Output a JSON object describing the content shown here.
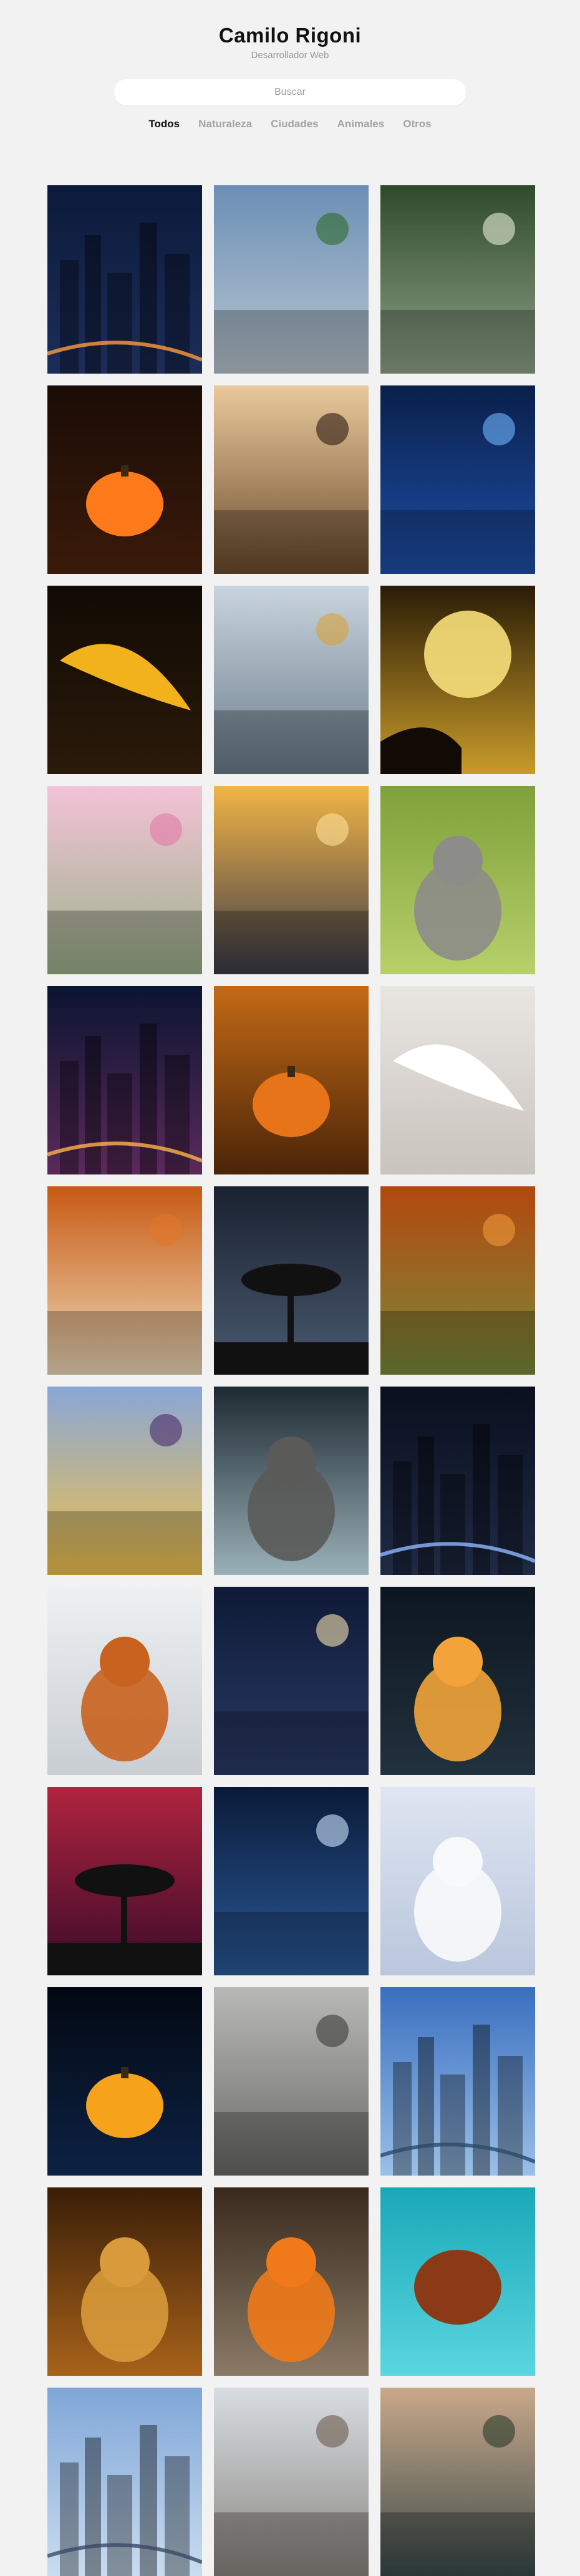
{
  "header": {
    "title": "Camilo Rigoni",
    "subtitle": "Desarrollador Web"
  },
  "search": {
    "placeholder": "Buscar"
  },
  "tabs": [
    {
      "label": "Todos",
      "active": true
    },
    {
      "label": "Naturaleza",
      "active": false
    },
    {
      "label": "Ciudades",
      "active": false
    },
    {
      "label": "Animales",
      "active": false
    },
    {
      "label": "Otros",
      "active": false
    }
  ],
  "gallery": [
    {
      "name": "city-night-traffic-photo",
      "bg": [
        "#0b1a3a",
        "#1c2d5a"
      ],
      "accent": "#ff9a3c",
      "motif": "city"
    },
    {
      "name": "seaside-promenade-photo",
      "bg": [
        "#6b8fb5",
        "#b9c6cf"
      ],
      "accent": "#2f6b2a",
      "motif": "street"
    },
    {
      "name": "forest-light-rays-photo",
      "bg": [
        "#2f4a2a",
        "#8fa28a"
      ],
      "accent": "#e6ecd9",
      "motif": "forest"
    },
    {
      "name": "halloween-pumpkin-spider-photo",
      "bg": [
        "#1a0c06",
        "#3a1a0a"
      ],
      "accent": "#ff7a1a",
      "motif": "pumpkin"
    },
    {
      "name": "misty-woods-deer-photo",
      "bg": [
        "#e9c99b",
        "#6b4a2c"
      ],
      "accent": "#2b1a10",
      "motif": "trees"
    },
    {
      "name": "blue-butterflies-photo",
      "bg": [
        "#0a1f4a",
        "#1f4fa8"
      ],
      "accent": "#6fb8ff",
      "motif": "butterfly"
    },
    {
      "name": "macaw-parrot-photo",
      "bg": [
        "#120a04",
        "#2a1a0a"
      ],
      "accent": "#f2b21b",
      "motif": "parrot"
    },
    {
      "name": "canal-boat-city-photo",
      "bg": [
        "#c9d4dd",
        "#6a7c8c"
      ],
      "accent": "#d8a23a",
      "motif": "canal"
    },
    {
      "name": "full-moon-bats-photo",
      "bg": [
        "#2a1c06",
        "#c89b2a"
      ],
      "accent": "#f7df7a",
      "motif": "moon"
    },
    {
      "name": "cherry-blossom-bridge-photo",
      "bg": [
        "#f3c3d6",
        "#9bb08a"
      ],
      "accent": "#e37aa6",
      "motif": "bridge"
    },
    {
      "name": "sunset-lake-photo",
      "bg": [
        "#f2b447",
        "#3a3a48"
      ],
      "accent": "#ffe09a",
      "motif": "lake"
    },
    {
      "name": "kitten-green-photo",
      "bg": [
        "#7fa03a",
        "#b7d06a"
      ],
      "accent": "#8c8c88",
      "motif": "cat"
    },
    {
      "name": "city-lights-aerial-photo",
      "bg": [
        "#0a1430",
        "#5b2a5a"
      ],
      "accent": "#ffb24a",
      "motif": "citylights"
    },
    {
      "name": "autumn-pumpkin-field-photo",
      "bg": [
        "#c46a16",
        "#4a2408"
      ],
      "accent": "#e8741a",
      "motif": "autumn"
    },
    {
      "name": "white-dove-photo",
      "bg": [
        "#e9e6e2",
        "#c9c3bd"
      ],
      "accent": "#ffffff",
      "motif": "dove"
    },
    {
      "name": "autumn-park-path-photo",
      "bg": [
        "#c85a14",
        "#efd9b8"
      ],
      "accent": "#e1772a",
      "motif": "park"
    },
    {
      "name": "bare-tree-moon-photo",
      "bg": [
        "#1a2230",
        "#4a5a70"
      ],
      "accent": "#d9d3c6",
      "motif": "baretree"
    },
    {
      "name": "autumn-forest-trail-photo",
      "bg": [
        "#b3480f",
        "#7a8a3a"
      ],
      "accent": "#f09a3a",
      "motif": "trail"
    },
    {
      "name": "sunset-mountains-photo",
      "bg": [
        "#8aa6d6",
        "#f0c24a"
      ],
      "accent": "#4a2a6a",
      "motif": "mountains"
    },
    {
      "name": "elephant-light-photo",
      "bg": [
        "#1e2a32",
        "#9ab0b8"
      ],
      "accent": "#5a5a58",
      "motif": "elephant"
    },
    {
      "name": "twin-light-beams-photo",
      "bg": [
        "#0a0f1e",
        "#1f2a44"
      ],
      "accent": "#8fb6ff",
      "motif": "beams"
    },
    {
      "name": "fox-snow-photo",
      "bg": [
        "#eef0f2",
        "#c9ced4"
      ],
      "accent": "#c9621e",
      "motif": "fox"
    },
    {
      "name": "capitol-night-photo",
      "bg": [
        "#0e1a36",
        "#2a3a66"
      ],
      "accent": "#f6e3b0",
      "motif": "capitol"
    },
    {
      "name": "rabbit-candles-photo",
      "bg": [
        "#0d1620",
        "#22313e"
      ],
      "accent": "#f2a43a",
      "motif": "rabbit"
    },
    {
      "name": "lone-tree-sunset-photo",
      "bg": [
        "#b0243e",
        "#3a0a2a"
      ],
      "accent": "#ff6a3a",
      "motif": "lonetree"
    },
    {
      "name": "bridge-river-night-photo",
      "bg": [
        "#0a1a38",
        "#2a5a9a"
      ],
      "accent": "#cfe6ff",
      "motif": "river"
    },
    {
      "name": "arctic-fox-snow-photo",
      "bg": [
        "#dfe6f2",
        "#b9c6dc"
      ],
      "accent": "#f8f9fb",
      "motif": "arcticfox"
    },
    {
      "name": "jack-o-lantern-photo",
      "bg": [
        "#020812",
        "#0d2244"
      ],
      "accent": "#f6a21a",
      "motif": "lantern"
    },
    {
      "name": "foggy-forest-photo",
      "bg": [
        "#b8b8b6",
        "#6a6a68"
      ],
      "accent": "#3a3a38",
      "motif": "fog"
    },
    {
      "name": "city-skyline-water-photo",
      "bg": [
        "#3a6fc0",
        "#9ac0e8"
      ],
      "accent": "#2a4a6a",
      "motif": "skyline"
    },
    {
      "name": "lion-portrait-photo",
      "bg": [
        "#3a1e08",
        "#a8621a"
      ],
      "accent": "#d89a3a",
      "motif": "lion"
    },
    {
      "name": "owl-eyes-photo",
      "bg": [
        "#3a2a1e",
        "#8a7a66"
      ],
      "accent": "#f07a1a",
      "motif": "owl"
    },
    {
      "name": "sea-turtle-photo",
      "bg": [
        "#1aa8b8",
        "#5ad6e0"
      ],
      "accent": "#8a3a16",
      "motif": "turtle"
    },
    {
      "name": "downtown-skyscrapers-photo",
      "bg": [
        "#7fa6d8",
        "#c9dcef"
      ],
      "accent": "#3a4a66",
      "motif": "downtown"
    },
    {
      "name": "winter-palace-trees-photo",
      "bg": [
        "#d8dde2",
        "#8a8680"
      ],
      "accent": "#6a5a4a",
      "motif": "palace"
    },
    {
      "name": "island-trees-lake-photo",
      "bg": [
        "#c9a88a",
        "#3a4a4a"
      ],
      "accent": "#2a3a2a",
      "motif": "island"
    }
  ]
}
